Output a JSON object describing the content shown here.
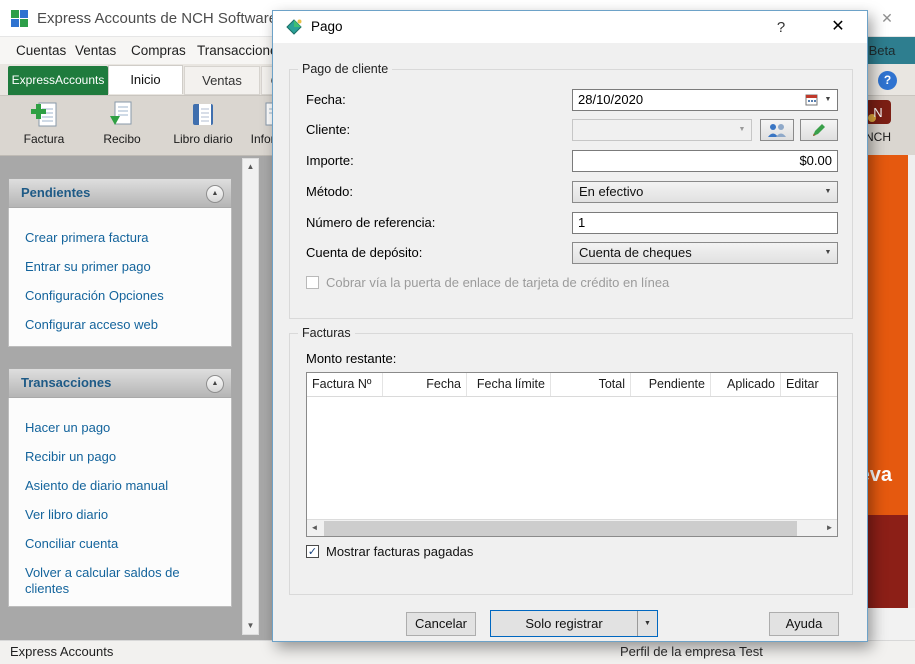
{
  "icons": {
    "close": "✕",
    "help": "?",
    "dropdown": "▼",
    "collapse": "▲",
    "scroll_up": "▲",
    "scroll_down": "▼",
    "scroll_left": "◄",
    "scroll_right": "►",
    "check": "✓"
  },
  "colors": {
    "accent_green": "#1f7b3d",
    "link_blue": "#14649c",
    "orange": "#e5590f",
    "dark_red": "#8c1f17",
    "teal": "#2e7e8f",
    "default_button_border": "#0067c0"
  },
  "main_window": {
    "title": "Express Accounts de NCH Software",
    "menu": {
      "items": [
        {
          "label": "Cuentas"
        },
        {
          "label": "Ventas"
        },
        {
          "label": "Compras"
        },
        {
          "label": "Transacciones"
        }
      ],
      "beta": "Beta"
    },
    "tabs": [
      {
        "label": "ExpressAccounts"
      },
      {
        "label": "Inicio"
      },
      {
        "label": "Ventas"
      },
      {
        "label": "Compras"
      }
    ],
    "toolbar": {
      "items": [
        {
          "label": "Factura"
        },
        {
          "label": "Recibo"
        },
        {
          "label": "Libro diario"
        },
        {
          "label": "Informes"
        }
      ],
      "nch_label": "NCH"
    },
    "sidebar": {
      "sections": [
        {
          "title": "Pendientes",
          "links": [
            {
              "label": "Crear primera factura"
            },
            {
              "label": "Entrar su primer pago"
            },
            {
              "label": "Configuración Opciones"
            },
            {
              "label": "Configurar acceso web"
            }
          ]
        },
        {
          "title": "Transacciones",
          "links": [
            {
              "label": "Hacer un pago"
            },
            {
              "label": "Recibir un pago"
            },
            {
              "label": "Asiento de diario manual"
            },
            {
              "label": "Ver libro diario"
            },
            {
              "label": "Conciliar cuenta"
            },
            {
              "label": "Volver a calcular saldos de clientes"
            }
          ]
        }
      ]
    },
    "right_panel": {
      "partial_text": "Nueva"
    },
    "status_bar": {
      "left": "Express Accounts",
      "company": "Perfil de la empresa Test"
    }
  },
  "dialog": {
    "title": "Pago",
    "payment_group": {
      "title": "Pago de cliente",
      "fecha_label": "Fecha:",
      "fecha_value": "28/10/2020",
      "cliente_label": "Cliente:",
      "cliente_value": "",
      "importe_label": "Importe:",
      "importe_value": "$0.00",
      "metodo_label": "Método:",
      "metodo_value": "En efectivo",
      "referencia_label": "Número de referencia:",
      "referencia_value": "1",
      "deposito_label": "Cuenta de depósito:",
      "deposito_value": "Cuenta de cheques",
      "gateway_label": "Cobrar vía la puerta de enlace de tarjeta de crédito en línea"
    },
    "invoices_group": {
      "title": "Facturas",
      "remaining_label": "Monto restante:",
      "columns": [
        {
          "label": "Factura Nº"
        },
        {
          "label": "Fecha"
        },
        {
          "label": "Fecha límite"
        },
        {
          "label": "Total"
        },
        {
          "label": "Pendiente"
        },
        {
          "label": "Aplicado"
        },
        {
          "label": "Editar"
        }
      ],
      "rows": [],
      "show_paid_label": "Mostrar facturas pagadas",
      "show_paid_checked": true
    },
    "buttons": {
      "cancel": "Cancelar",
      "register": "Solo registrar",
      "help": "Ayuda"
    }
  }
}
